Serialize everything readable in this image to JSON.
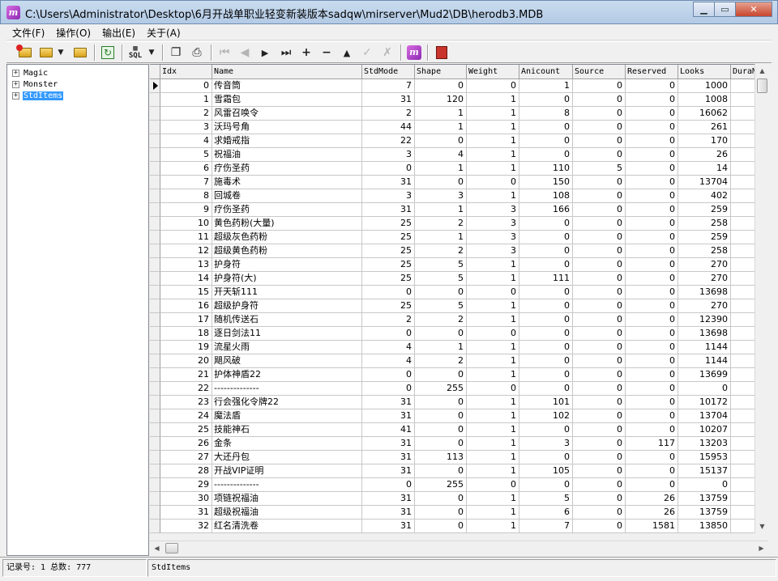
{
  "window": {
    "title": "C:\\Users\\Administrator\\Desktop\\6月开战单职业轻变新装版本sadqw\\mirserver\\Mud2\\DB\\herodb3.MDB",
    "app_badge": "m"
  },
  "menu": [
    {
      "label": "文件(F)"
    },
    {
      "label": "操作(O)"
    },
    {
      "label": "输出(E)"
    },
    {
      "label": "关于(A)"
    }
  ],
  "toolbar": {
    "sql_label": "SQL"
  },
  "tree": [
    {
      "label": "Magic",
      "expander": "+"
    },
    {
      "label": "Monster",
      "expander": "+"
    },
    {
      "label": "StdItems",
      "expander": "+",
      "selected": true
    }
  ],
  "grid": {
    "columns": [
      "Idx",
      "Name",
      "StdMode",
      "Shape",
      "Weight",
      "Anicount",
      "Source",
      "Reserved",
      "Looks",
      "DuraMax"
    ],
    "rows": [
      [
        "0",
        "传音筒",
        "7",
        "0",
        "0",
        "1",
        "0",
        "0",
        "1000"
      ],
      [
        "1",
        "雪霜包",
        "31",
        "120",
        "1",
        "0",
        "0",
        "0",
        "1008"
      ],
      [
        "2",
        "风雷召唤令",
        "2",
        "1",
        "1",
        "8",
        "0",
        "0",
        "16062"
      ],
      [
        "3",
        "沃玛号角",
        "44",
        "1",
        "1",
        "0",
        "0",
        "0",
        "261"
      ],
      [
        "4",
        "求婚戒指",
        "22",
        "0",
        "1",
        "0",
        "0",
        "0",
        "170"
      ],
      [
        "5",
        "祝福油",
        "3",
        "4",
        "1",
        "0",
        "0",
        "0",
        "26"
      ],
      [
        "6",
        "疗伤圣药",
        "0",
        "1",
        "1",
        "110",
        "5",
        "0",
        "14"
      ],
      [
        "7",
        "施毒术",
        "31",
        "0",
        "0",
        "150",
        "0",
        "0",
        "13704"
      ],
      [
        "8",
        "回城卷",
        "3",
        "3",
        "1",
        "108",
        "0",
        "0",
        "402"
      ],
      [
        "9",
        "疗伤圣药",
        "31",
        "1",
        "3",
        "166",
        "0",
        "0",
        "259"
      ],
      [
        "10",
        "黄色药粉(大量)",
        "25",
        "2",
        "3",
        "0",
        "0",
        "0",
        "258"
      ],
      [
        "11",
        "超级灰色药粉",
        "25",
        "1",
        "3",
        "0",
        "0",
        "0",
        "259"
      ],
      [
        "12",
        "超级黄色药粉",
        "25",
        "2",
        "3",
        "0",
        "0",
        "0",
        "258"
      ],
      [
        "13",
        "护身符",
        "25",
        "5",
        "1",
        "0",
        "0",
        "0",
        "270"
      ],
      [
        "14",
        "护身符(大)",
        "25",
        "5",
        "1",
        "111",
        "0",
        "0",
        "270"
      ],
      [
        "15",
        "开天斩111",
        "0",
        "0",
        "0",
        "0",
        "0",
        "0",
        "13698"
      ],
      [
        "16",
        "超级护身符",
        "25",
        "5",
        "1",
        "0",
        "0",
        "0",
        "270"
      ],
      [
        "17",
        "随机传送石",
        "2",
        "2",
        "1",
        "0",
        "0",
        "0",
        "12390"
      ],
      [
        "18",
        "逐日剑法11",
        "0",
        "0",
        "0",
        "0",
        "0",
        "0",
        "13698"
      ],
      [
        "19",
        "流星火雨",
        "4",
        "1",
        "1",
        "0",
        "0",
        "0",
        "1144"
      ],
      [
        "20",
        "飓风破",
        "4",
        "2",
        "1",
        "0",
        "0",
        "0",
        "1144"
      ],
      [
        "21",
        "护体神盾22",
        "0",
        "0",
        "1",
        "0",
        "0",
        "0",
        "13699"
      ],
      [
        "22",
        "--------------",
        "0",
        "255",
        "0",
        "0",
        "0",
        "0",
        "0"
      ],
      [
        "23",
        "行会强化令牌22",
        "31",
        "0",
        "1",
        "101",
        "0",
        "0",
        "10172"
      ],
      [
        "24",
        "魔法盾",
        "31",
        "0",
        "1",
        "102",
        "0",
        "0",
        "13704"
      ],
      [
        "25",
        "技能神石",
        "41",
        "0",
        "1",
        "0",
        "0",
        "0",
        "10207"
      ],
      [
        "26",
        "金条",
        "31",
        "0",
        "1",
        "3",
        "0",
        "117",
        "13203"
      ],
      [
        "27",
        "大还丹包",
        "31",
        "113",
        "1",
        "0",
        "0",
        "0",
        "15953"
      ],
      [
        "28",
        "开战VIP证明",
        "31",
        "0",
        "1",
        "105",
        "0",
        "0",
        "15137"
      ],
      [
        "29",
        "--------------",
        "0",
        "255",
        "0",
        "0",
        "0",
        "0",
        "0"
      ],
      [
        "30",
        "项链祝福油",
        "31",
        "0",
        "1",
        "5",
        "0",
        "26",
        "13759"
      ],
      [
        "31",
        "超级祝福油",
        "31",
        "0",
        "1",
        "6",
        "0",
        "26",
        "13759"
      ],
      [
        "32",
        "红名清洗卷",
        "31",
        "0",
        "1",
        "7",
        "0",
        "1581",
        "13850"
      ]
    ]
  },
  "status": {
    "record": "记录号: 1 总数: 777",
    "table": "StdItems"
  }
}
